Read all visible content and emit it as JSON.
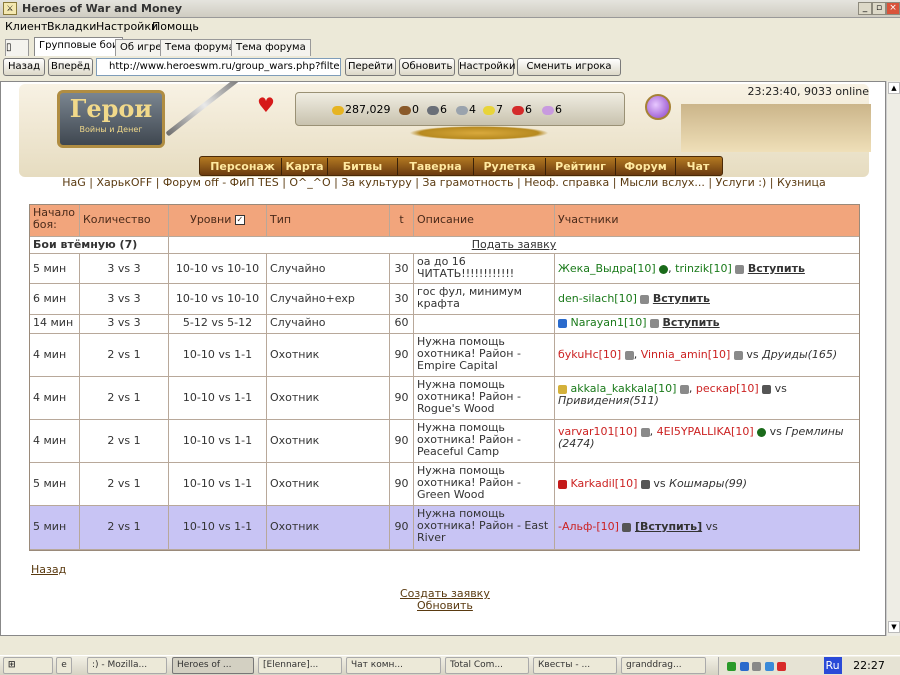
{
  "window": {
    "title": "Heroes of War and Money"
  },
  "menu": [
    "Клиент",
    "Вкладки",
    "Настройки",
    "Помощь"
  ],
  "tabs": [
    "Групповые бои",
    "Об игре",
    "Тема форума",
    "Тема форума"
  ],
  "nav": {
    "back": "Назад",
    "forward": "Вперёд",
    "url": "http://www.heroeswm.ru/group_wars.php?filter=hunt",
    "go": "Перейти",
    "refresh": "Обновить",
    "settings": "Настройки",
    "change_player": "Сменить игрока"
  },
  "status": "23:23:40, 9033 online",
  "logo": {
    "title": "Герои",
    "subtitle": "Войны и Денег"
  },
  "resources": [
    "287,029",
    "0",
    "6",
    "4",
    "7",
    "6"
  ],
  "game_nav": [
    "Персонаж",
    "Карта",
    "Битвы",
    "Таверна",
    "Рулетка",
    "Рейтинг",
    "Форум",
    "Чат"
  ],
  "links": "HaG | ХарькOFF | Форум off - ФиП TES | О^_^О | За культуру | За грамотность | Неоф. справка | Мысли вслух... | Услуги :) | Кузница",
  "table": {
    "headers": [
      "Начало боя:",
      "Количество",
      "Уровни",
      "Тип",
      "t",
      "Описание",
      "Участники"
    ],
    "section": "Бои втёмную (7)",
    "submit": "Подать заявку",
    "rows": [
      {
        "start": "5 мин",
        "count": "3 vs 3",
        "levels": "10-10 vs 10-10",
        "type": "Случайно",
        "t": "30",
        "desc": "оа до 16 ЧИТАТЬ!!!!!!!!!!!!",
        "p1": "Жека_Выдра[10]",
        "sep": ",",
        "p2": "trinzik[10]",
        "join": "Вступить",
        "vs": "",
        "enemy": ""
      },
      {
        "start": "6 мин",
        "count": "3 vs 3",
        "levels": "10-10 vs 10-10",
        "type": "Случайно+exp",
        "t": "30",
        "desc": "гос фул, минимум крафта",
        "p1": "den-silach[10]",
        "sep": "",
        "p2": "",
        "join": "Вступить",
        "vs": "",
        "enemy": ""
      },
      {
        "start": "14 мин",
        "count": "3 vs 3",
        "levels": "5-12 vs 5-12",
        "type": "Случайно",
        "t": "60",
        "desc": "",
        "p1": "Narayan1[10]",
        "sep": "",
        "p2": "",
        "join": "Вступить",
        "vs": "",
        "enemy": ""
      },
      {
        "start": "4 мин",
        "count": "2 vs 1",
        "levels": "10-10 vs 1-1",
        "type": "Охотник",
        "t": "90",
        "desc": "Нужна помощь охотника! Район - Empire Capital",
        "p1": "бykuHc[10]",
        "sep": ",",
        "p2": "Vinnia_amin[10]",
        "join": "",
        "vs": "vs",
        "enemy": "Друиды(165)"
      },
      {
        "start": "4 мин",
        "count": "2 vs 1",
        "levels": "10-10 vs 1-1",
        "type": "Охотник",
        "t": "90",
        "desc": "Нужна помощь охотника! Район - Rogue's Wood",
        "p1": "akkala_kakkala[10]",
        "sep": ",",
        "p2": "рескар[10]",
        "join": "",
        "vs": "vs",
        "enemy": "Привидения(511)"
      },
      {
        "start": "4 мин",
        "count": "2 vs 1",
        "levels": "10-10 vs 1-1",
        "type": "Охотник",
        "t": "90",
        "desc": "Нужна помощь охотника! Район - Peaceful Camp",
        "p1": "varvar101[10]",
        "sep": ",",
        "p2": "4EI5YPALLIKA[10]",
        "join": "",
        "vs": "vs",
        "enemy": "Гремлины (2474)"
      },
      {
        "start": "5 мин",
        "count": "2 vs 1",
        "levels": "10-10 vs 1-1",
        "type": "Охотник",
        "t": "90",
        "desc": "Нужна помощь охотника! Район - Green Wood",
        "p1": "Karkadil[10]",
        "sep": "",
        "p2": "",
        "join": "",
        "vs": "vs",
        "enemy": "Кошмары(99)"
      },
      {
        "start": "5 мин",
        "count": "2 vs 1",
        "levels": "10-10 vs 1-1",
        "type": "Охотник",
        "t": "90",
        "desc": "Нужна помощь охотника! Район - East River",
        "p1": "-Альф-[10]",
        "sep": "",
        "p2": "",
        "join": "[Вступить]",
        "vs": "vs",
        "enemy": ""
      }
    ]
  },
  "bottom": {
    "back": "Назад",
    "create": "Создать заявку",
    "refresh": "Обновить"
  },
  "taskbar": {
    "items": [
      ":) - Mozilla...",
      "Heroes of ...",
      "[Elennare]...",
      "Чат комн...",
      "Total Com...",
      "Квесты - ...",
      "granddrag..."
    ],
    "lang": "Ru",
    "time": "22:27"
  }
}
